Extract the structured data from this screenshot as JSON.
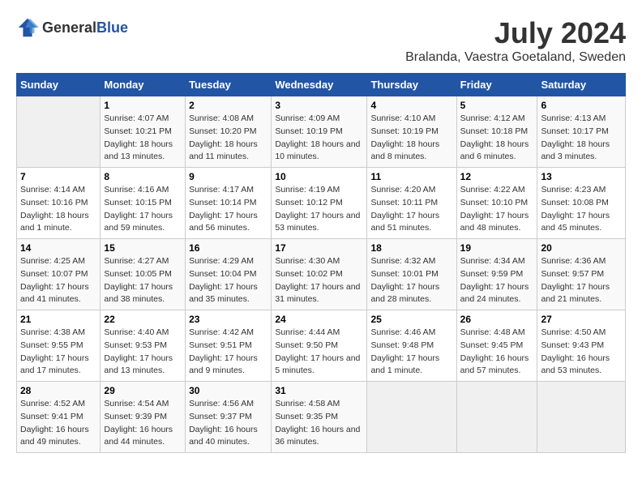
{
  "header": {
    "logo_general": "General",
    "logo_blue": "Blue",
    "title": "July 2024",
    "subtitle": "Bralanda, Vaestra Goetaland, Sweden"
  },
  "weekdays": [
    "Sunday",
    "Monday",
    "Tuesday",
    "Wednesday",
    "Thursday",
    "Friday",
    "Saturday"
  ],
  "weeks": [
    [
      {
        "day": "",
        "sunrise": "",
        "sunset": "",
        "daylight": ""
      },
      {
        "day": "1",
        "sunrise": "Sunrise: 4:07 AM",
        "sunset": "Sunset: 10:21 PM",
        "daylight": "Daylight: 18 hours and 13 minutes."
      },
      {
        "day": "2",
        "sunrise": "Sunrise: 4:08 AM",
        "sunset": "Sunset: 10:20 PM",
        "daylight": "Daylight: 18 hours and 11 minutes."
      },
      {
        "day": "3",
        "sunrise": "Sunrise: 4:09 AM",
        "sunset": "Sunset: 10:19 PM",
        "daylight": "Daylight: 18 hours and 10 minutes."
      },
      {
        "day": "4",
        "sunrise": "Sunrise: 4:10 AM",
        "sunset": "Sunset: 10:19 PM",
        "daylight": "Daylight: 18 hours and 8 minutes."
      },
      {
        "day": "5",
        "sunrise": "Sunrise: 4:12 AM",
        "sunset": "Sunset: 10:18 PM",
        "daylight": "Daylight: 18 hours and 6 minutes."
      },
      {
        "day": "6",
        "sunrise": "Sunrise: 4:13 AM",
        "sunset": "Sunset: 10:17 PM",
        "daylight": "Daylight: 18 hours and 3 minutes."
      }
    ],
    [
      {
        "day": "7",
        "sunrise": "Sunrise: 4:14 AM",
        "sunset": "Sunset: 10:16 PM",
        "daylight": "Daylight: 18 hours and 1 minute."
      },
      {
        "day": "8",
        "sunrise": "Sunrise: 4:16 AM",
        "sunset": "Sunset: 10:15 PM",
        "daylight": "Daylight: 17 hours and 59 minutes."
      },
      {
        "day": "9",
        "sunrise": "Sunrise: 4:17 AM",
        "sunset": "Sunset: 10:14 PM",
        "daylight": "Daylight: 17 hours and 56 minutes."
      },
      {
        "day": "10",
        "sunrise": "Sunrise: 4:19 AM",
        "sunset": "Sunset: 10:12 PM",
        "daylight": "Daylight: 17 hours and 53 minutes."
      },
      {
        "day": "11",
        "sunrise": "Sunrise: 4:20 AM",
        "sunset": "Sunset: 10:11 PM",
        "daylight": "Daylight: 17 hours and 51 minutes."
      },
      {
        "day": "12",
        "sunrise": "Sunrise: 4:22 AM",
        "sunset": "Sunset: 10:10 PM",
        "daylight": "Daylight: 17 hours and 48 minutes."
      },
      {
        "day": "13",
        "sunrise": "Sunrise: 4:23 AM",
        "sunset": "Sunset: 10:08 PM",
        "daylight": "Daylight: 17 hours and 45 minutes."
      }
    ],
    [
      {
        "day": "14",
        "sunrise": "Sunrise: 4:25 AM",
        "sunset": "Sunset: 10:07 PM",
        "daylight": "Daylight: 17 hours and 41 minutes."
      },
      {
        "day": "15",
        "sunrise": "Sunrise: 4:27 AM",
        "sunset": "Sunset: 10:05 PM",
        "daylight": "Daylight: 17 hours and 38 minutes."
      },
      {
        "day": "16",
        "sunrise": "Sunrise: 4:29 AM",
        "sunset": "Sunset: 10:04 PM",
        "daylight": "Daylight: 17 hours and 35 minutes."
      },
      {
        "day": "17",
        "sunrise": "Sunrise: 4:30 AM",
        "sunset": "Sunset: 10:02 PM",
        "daylight": "Daylight: 17 hours and 31 minutes."
      },
      {
        "day": "18",
        "sunrise": "Sunrise: 4:32 AM",
        "sunset": "Sunset: 10:01 PM",
        "daylight": "Daylight: 17 hours and 28 minutes."
      },
      {
        "day": "19",
        "sunrise": "Sunrise: 4:34 AM",
        "sunset": "Sunset: 9:59 PM",
        "daylight": "Daylight: 17 hours and 24 minutes."
      },
      {
        "day": "20",
        "sunrise": "Sunrise: 4:36 AM",
        "sunset": "Sunset: 9:57 PM",
        "daylight": "Daylight: 17 hours and 21 minutes."
      }
    ],
    [
      {
        "day": "21",
        "sunrise": "Sunrise: 4:38 AM",
        "sunset": "Sunset: 9:55 PM",
        "daylight": "Daylight: 17 hours and 17 minutes."
      },
      {
        "day": "22",
        "sunrise": "Sunrise: 4:40 AM",
        "sunset": "Sunset: 9:53 PM",
        "daylight": "Daylight: 17 hours and 13 minutes."
      },
      {
        "day": "23",
        "sunrise": "Sunrise: 4:42 AM",
        "sunset": "Sunset: 9:51 PM",
        "daylight": "Daylight: 17 hours and 9 minutes."
      },
      {
        "day": "24",
        "sunrise": "Sunrise: 4:44 AM",
        "sunset": "Sunset: 9:50 PM",
        "daylight": "Daylight: 17 hours and 5 minutes."
      },
      {
        "day": "25",
        "sunrise": "Sunrise: 4:46 AM",
        "sunset": "Sunset: 9:48 PM",
        "daylight": "Daylight: 17 hours and 1 minute."
      },
      {
        "day": "26",
        "sunrise": "Sunrise: 4:48 AM",
        "sunset": "Sunset: 9:45 PM",
        "daylight": "Daylight: 16 hours and 57 minutes."
      },
      {
        "day": "27",
        "sunrise": "Sunrise: 4:50 AM",
        "sunset": "Sunset: 9:43 PM",
        "daylight": "Daylight: 16 hours and 53 minutes."
      }
    ],
    [
      {
        "day": "28",
        "sunrise": "Sunrise: 4:52 AM",
        "sunset": "Sunset: 9:41 PM",
        "daylight": "Daylight: 16 hours and 49 minutes."
      },
      {
        "day": "29",
        "sunrise": "Sunrise: 4:54 AM",
        "sunset": "Sunset: 9:39 PM",
        "daylight": "Daylight: 16 hours and 44 minutes."
      },
      {
        "day": "30",
        "sunrise": "Sunrise: 4:56 AM",
        "sunset": "Sunset: 9:37 PM",
        "daylight": "Daylight: 16 hours and 40 minutes."
      },
      {
        "day": "31",
        "sunrise": "Sunrise: 4:58 AM",
        "sunset": "Sunset: 9:35 PM",
        "daylight": "Daylight: 16 hours and 36 minutes."
      },
      {
        "day": "",
        "sunrise": "",
        "sunset": "",
        "daylight": ""
      },
      {
        "day": "",
        "sunrise": "",
        "sunset": "",
        "daylight": ""
      },
      {
        "day": "",
        "sunrise": "",
        "sunset": "",
        "daylight": ""
      }
    ]
  ]
}
